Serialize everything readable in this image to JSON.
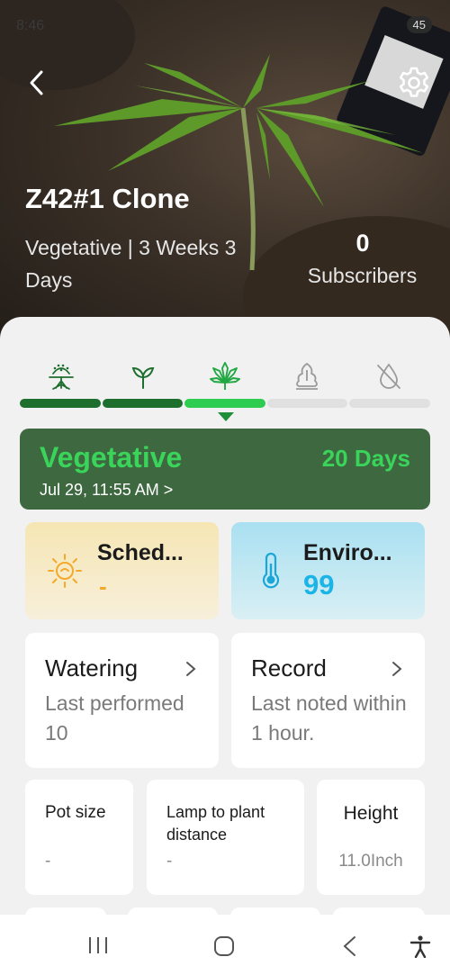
{
  "status_bar": {
    "time": "8:46",
    "battery": "45"
  },
  "header": {
    "plant_name": "Z42#1 Clone",
    "stage_line": "Vegetative | 3 Weeks 3 Days",
    "subscribers_count": "0",
    "subscribers_label": "Subscribers"
  },
  "stages": [
    {
      "icon": "germination-icon",
      "status": "done"
    },
    {
      "icon": "seedling-icon",
      "status": "done"
    },
    {
      "icon": "vegetative-leaf-icon",
      "status": "active"
    },
    {
      "icon": "flowering-bud-icon",
      "status": "pending"
    },
    {
      "icon": "drying-drop-off-icon",
      "status": "pending"
    }
  ],
  "current_stage": {
    "name": "Vegetative",
    "days": "20 Days",
    "date": "Jul 29, 11:55 AM >"
  },
  "schedule": {
    "label": "Sched...",
    "value": "-",
    "icon": "sun-icon"
  },
  "environment": {
    "label": "Enviro...",
    "value": "99",
    "icon": "thermometer-icon"
  },
  "watering": {
    "title": "Watering",
    "subtitle": "Last performed 10"
  },
  "record": {
    "title": "Record",
    "subtitle": "Last noted within 1 hour."
  },
  "metrics": {
    "pot_size": {
      "label": "Pot size",
      "value": "-"
    },
    "lamp_distance": {
      "label": "Lamp to plant distance",
      "value": "-"
    },
    "height": {
      "label": "Height",
      "value": "11.0Inch"
    }
  },
  "colors": {
    "stage_card": "#3d6840",
    "accent_green": "#3ad45a",
    "progress_done": "#1e6e2e",
    "schedule_value": "#f3a92a",
    "environment_value": "#1bb4e6"
  }
}
